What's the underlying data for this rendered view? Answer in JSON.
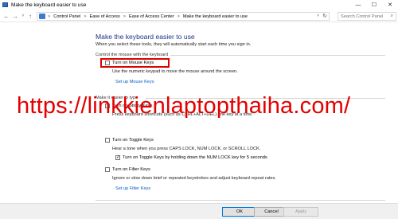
{
  "window": {
    "title": "Make the keyboard easier to use",
    "minimize": "—",
    "maximize": "☐",
    "close": "✕"
  },
  "nav": {
    "back": "←",
    "forward": "→",
    "up": "↑",
    "recent": "˅",
    "breadcrumb": [
      "Control Panel",
      "Ease of Access",
      "Ease of Access Center",
      "Make the keyboard easier to use"
    ],
    "separator": ">",
    "dropdown": "˅",
    "refresh": "↻",
    "search_placeholder": "Search Control Panel",
    "search_icon": "⌕"
  },
  "page": {
    "heading": "Make the keyboard easier to use",
    "description": "When you select these tools, they will automatically start each time you sign in."
  },
  "mouse_section": {
    "title": "Control the mouse with the keyboard",
    "mouse_keys_label": "Turn on Mouse Keys",
    "mouse_keys_desc": "Use the numeric keypad to move the mouse around the screen.",
    "setup_link": "Set up Mouse Keys"
  },
  "typing_section": {
    "title": "Make it easier to type",
    "sticky_label": "Turn on Sticky Keys",
    "sticky_desc": "Press keyboard shortcuts (such as CTRL+ALT+DEL) one key at a time.",
    "toggle_label": "Turn on Toggle Keys",
    "toggle_desc": "Hear a tone when you press CAPS LOCK, NUM LOCK, or SCROLL LOCK.",
    "toggle_sub_label": "Turn on Toggle Keys by holding down the NUM LOCK key for 5 seconds",
    "filter_label": "Turn on Filter Keys",
    "filter_desc": "Ignore or slow down brief or repeated keystrokes and adjust keyboard repeat rates.",
    "filter_link": "Set up Filter Keys"
  },
  "checkboxes": {
    "mouse_keys": false,
    "sticky_keys": false,
    "toggle_keys": false,
    "toggle_keys_hold": true,
    "filter_keys": false
  },
  "watermark": "https://linkkienlaptopthaiha.com/",
  "buttons": {
    "ok": "OK",
    "cancel": "Cancel",
    "apply": "Apply"
  },
  "colors": {
    "heading": "#1e3287",
    "link": "#0a5bc4",
    "highlight": "#e00000",
    "watermark": "#e40000"
  }
}
